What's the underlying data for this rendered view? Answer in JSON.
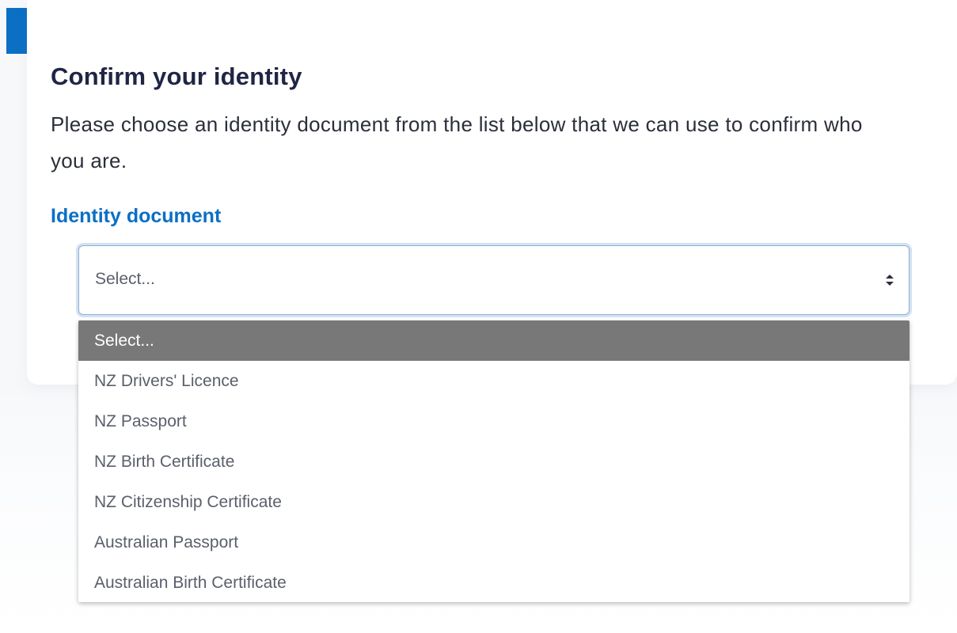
{
  "card": {
    "title": "Confirm your identity",
    "description": "Please choose an identity document from the list below that we can use to confirm who you are."
  },
  "field": {
    "label": "Identity document",
    "selected_value": "Select...",
    "arrow_icon": "sort-arrows-icon"
  },
  "dropdown": {
    "options": [
      "Select...",
      "NZ Drivers' Licence",
      "NZ Passport",
      "NZ Birth Certificate",
      "NZ Citizenship Certificate",
      "Australian Passport",
      "Australian Birth Certificate"
    ],
    "highlighted_index": 0
  },
  "colors": {
    "accent": "#0b6fc4",
    "title": "#1f2544",
    "highlight": "#787878"
  }
}
